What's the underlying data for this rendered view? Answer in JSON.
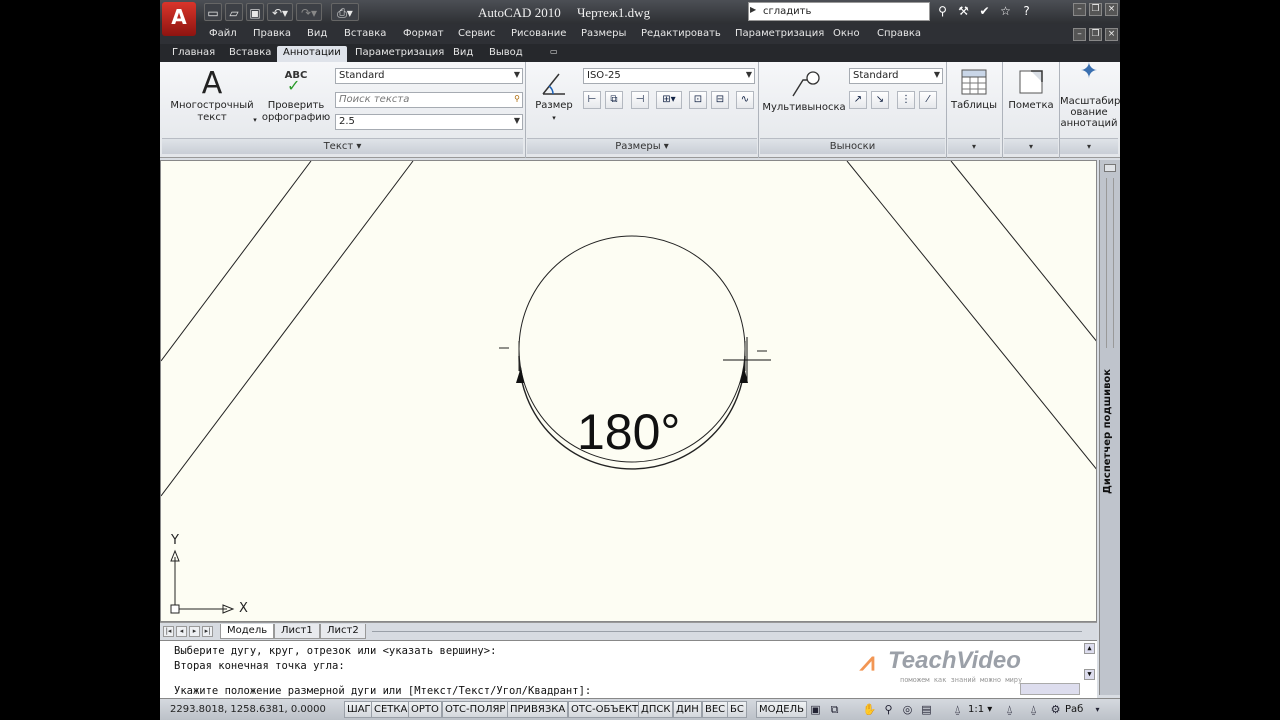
{
  "app": {
    "logo": "A",
    "title": "AutoCAD 2010",
    "file": "Чертеж1.dwg",
    "search_value": "сгладить"
  },
  "qat": {
    "icons": [
      "new-icon",
      "open-icon",
      "save-icon",
      "undo-icon",
      "redo-icon",
      "plot-icon"
    ]
  },
  "menu": [
    "Файл",
    "Правка",
    "Вид",
    "Вставка",
    "Формат",
    "Сервис",
    "Рисование",
    "Размеры",
    "Редактировать",
    "Параметризация",
    "Окно",
    "Справка"
  ],
  "ribbon_tabs": [
    "Главная",
    "Вставка",
    "Аннотации",
    "Параметризация",
    "Вид",
    "Вывод"
  ],
  "ribbon": {
    "text_panel": {
      "title": "Текст",
      "mtext_label_1": "Многострочный",
      "mtext_label_2": "текст",
      "spell_icon_text": "ABC",
      "spell_label_1": "Проверить",
      "spell_label_2": "орфографию",
      "style_value": "Standard",
      "find_placeholder": "Поиск текста",
      "height_value": "2.5"
    },
    "dim_panel": {
      "title": "Размеры",
      "dim_label": "Размер",
      "style_value": "ISO-25"
    },
    "leader_panel": {
      "title": "Выноски",
      "mleader_label": "Мультивыноска",
      "style_value": "Standard"
    },
    "tables_label": "Таблицы",
    "markup_label": "Пометка",
    "scale_label_1": "Масштабир",
    "scale_label_2": "ование",
    "scale_label_3": "аннотаций"
  },
  "drawing": {
    "dimension_text": "180°",
    "ucs_x": "X",
    "ucs_y": "Y"
  },
  "sheet_tabs": [
    "Модель",
    "Лист1",
    "Лист2"
  ],
  "side_palette": "Диспетчер подшивок",
  "command": {
    "line1": "Выберите дугу, круг, отрезок или <указать вершину>:",
    "line2": "Вторая конечная точка угла:",
    "line3": "Укажите положение размерной дуги или [Мтекст/Текст/Угол/Квадрант]:"
  },
  "watermark": {
    "brand": "TeachVideo",
    "tagline": "поможем как знаний можно миру"
  },
  "status": {
    "coords": "2293.8018, 1258.6381, 0.0000",
    "toggles": [
      "ШАГ",
      "СЕТКА",
      "ОРТО",
      "ОТС-ПОЛЯР",
      "ПРИВЯЗКА",
      "ОТС-ОБЪЕКТ",
      "ДПСК",
      "ДИН",
      "ВЕС",
      "БС"
    ],
    "model": "МОДЕЛЬ",
    "scale": "1:1",
    "workspace": "Раб"
  }
}
